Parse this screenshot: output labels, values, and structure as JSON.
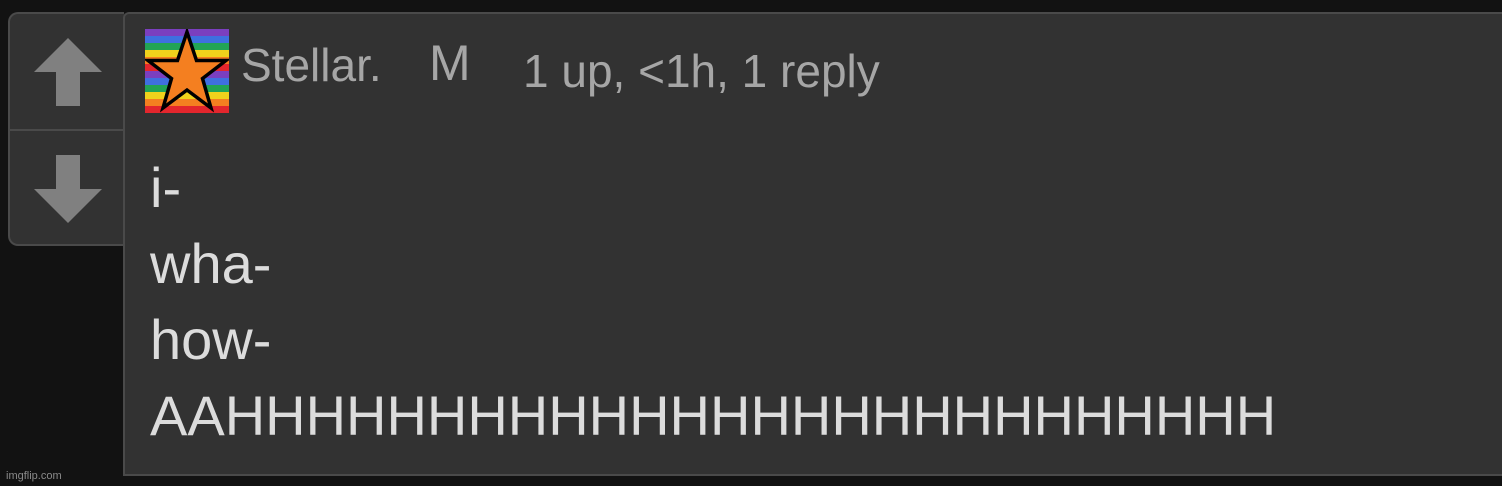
{
  "colors": {
    "page_background": "#121212",
    "panel_background": "#323232",
    "panel_border": "#4a4a4a",
    "vote_arrow": "#808080",
    "muted_text": "#a6a6a6",
    "body_text": "#dcdcdc",
    "star_fill": "#f47f20"
  },
  "vote": {
    "up_icon": "up-arrow-icon",
    "down_icon": "down-arrow-icon"
  },
  "comment": {
    "avatar_icon": "rainbow-star-avatar-icon",
    "username": "Stellar.",
    "badge": "M",
    "meta": "1 up, <1h, 1 reply",
    "lines": [
      "i-",
      "wha-",
      "how-",
      "AAHHHHHHHHHHHHHHHHHHHHHHHHHH"
    ]
  },
  "watermark": "imgflip.com"
}
